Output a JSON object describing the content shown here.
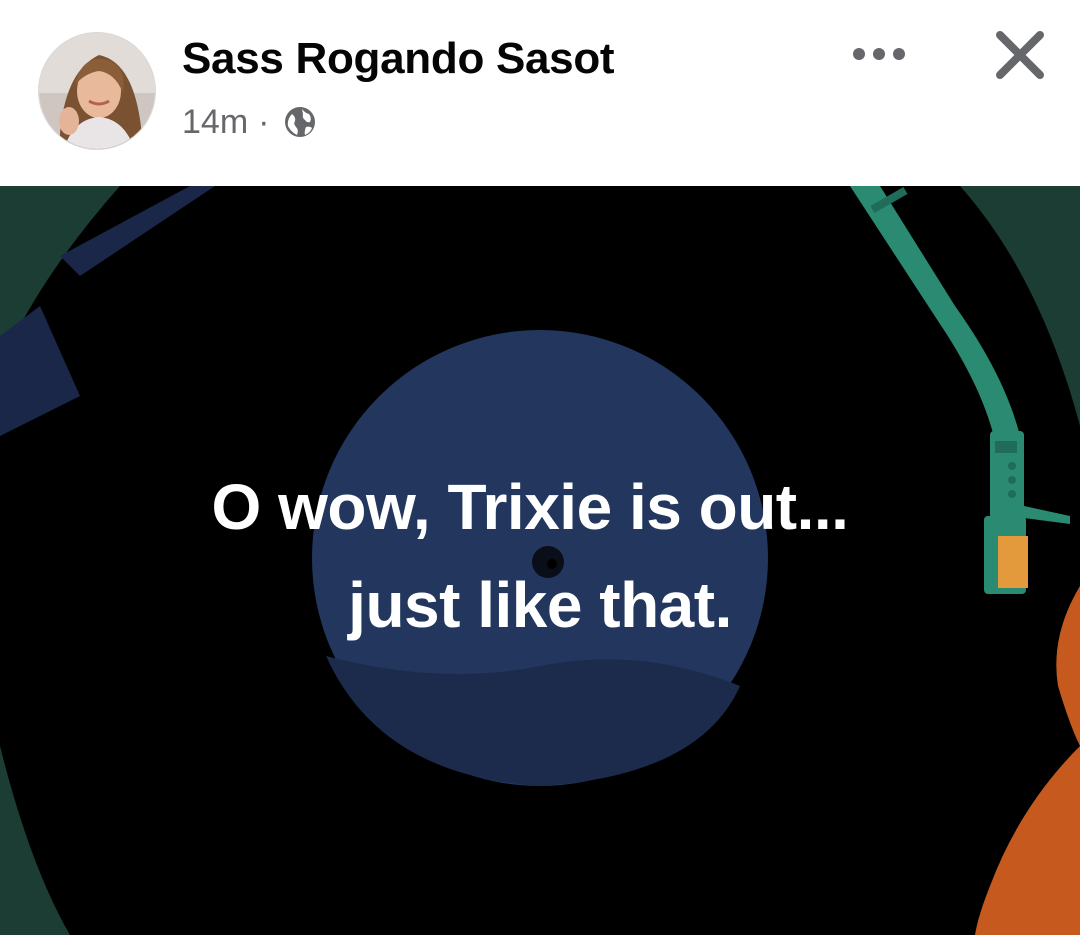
{
  "post": {
    "author": "Sass Rogando Sasot",
    "time_ago": "14m",
    "separator": "·",
    "privacy_icon": "globe-icon",
    "more_icon": "more-options-icon",
    "close_icon": "close-icon",
    "text_lines": [
      "O wow, Trixie is out...",
      "just like that."
    ]
  },
  "colors": {
    "name_text": "#050505",
    "meta_text": "#65676b",
    "record_black": "#000000",
    "label_blue": "#22365e",
    "corner_green": "#1b3d33",
    "tonearm_teal": "#2a8a72",
    "accent_orange": "#c65a1e"
  }
}
